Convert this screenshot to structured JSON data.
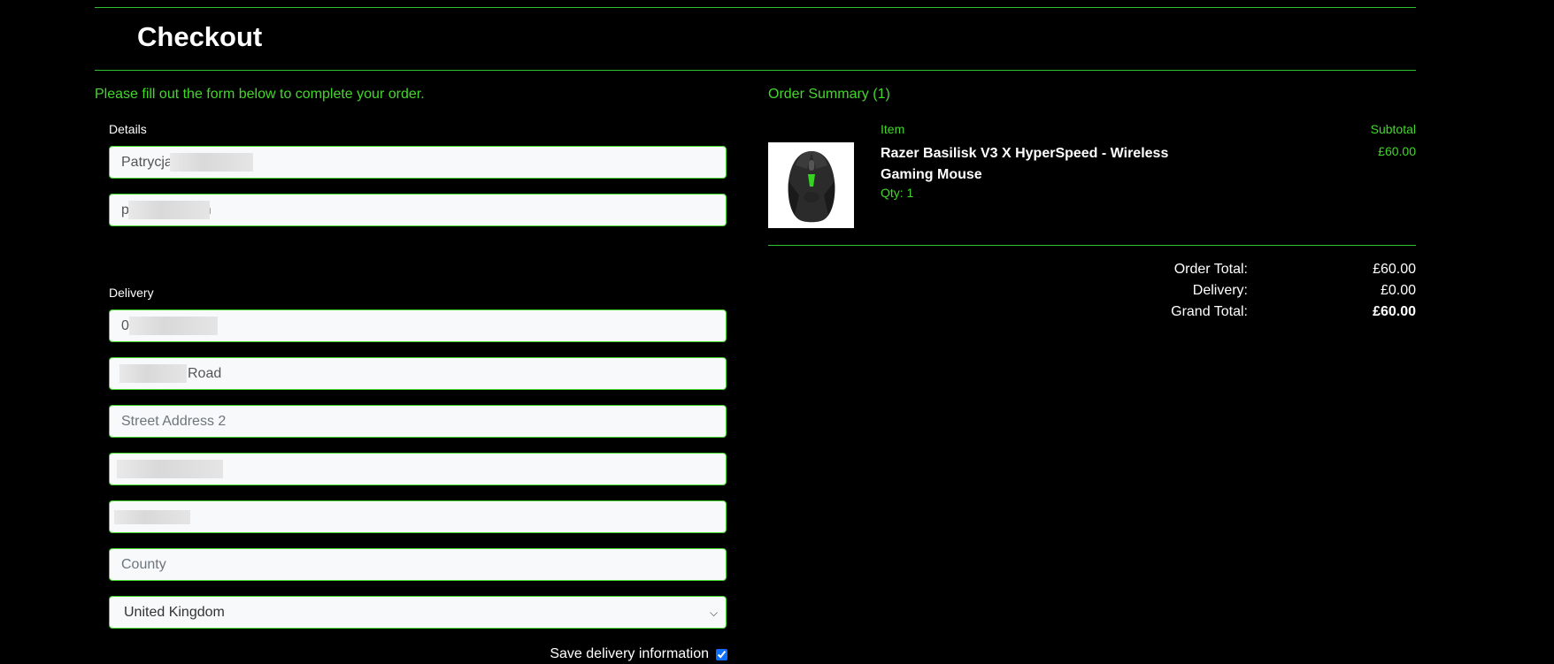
{
  "header": {
    "title": "Checkout"
  },
  "form": {
    "intro": "Please fill out the form below to complete your order.",
    "details_label": "Details",
    "full_name_value": "Patrycja",
    "email_value": "p@icloud.com",
    "delivery_label": "Delivery",
    "phone_value": "0",
    "street1_value": "Road",
    "street2_placeholder": "Street Address 2",
    "town_value": "",
    "postcode_value": "",
    "county_placeholder": "County",
    "country_selected": "United Kingdom",
    "save_label": "Save delivery information",
    "save_checked": true
  },
  "summary": {
    "title": "Order Summary (1)",
    "col_item": "Item",
    "col_subtotal": "Subtotal",
    "items": [
      {
        "name": "Razer Basilisk V3 X HyperSpeed - Wireless Gaming Mouse",
        "qty": "Qty: 1",
        "subtotal": "£60.00",
        "image_icon": "gaming-mouse-icon"
      }
    ],
    "order_total_label": "Order Total:",
    "order_total": "£60.00",
    "delivery_label": "Delivery:",
    "delivery": "£0.00",
    "grand_total_label": "Grand Total:",
    "grand_total": "£60.00"
  },
  "colors": {
    "accent": "#44d62c",
    "background": "#000000",
    "field_bg": "#f8f9fa"
  }
}
